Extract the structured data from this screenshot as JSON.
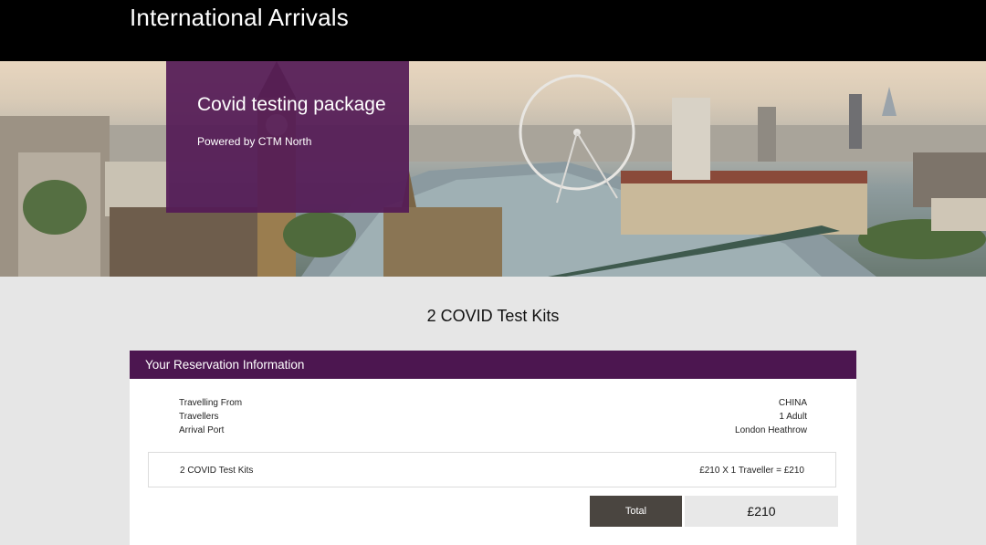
{
  "header": {
    "title": "International Arrivals"
  },
  "hero": {
    "image": "London skyline panorama with London Eye, River Thames and Big Ben",
    "promo": {
      "title": "Covid testing package",
      "subtitle": "Powered by CTM North"
    }
  },
  "product": {
    "heading": "2 COVID Test Kits"
  },
  "reservation": {
    "header": "Your Reservation Information",
    "details": [
      {
        "label": "Travelling From",
        "value": "CHINA"
      },
      {
        "label": "Travellers",
        "value": "1 Adult"
      },
      {
        "label": "Arrival Port",
        "value": "London Heathrow"
      }
    ],
    "line_item": {
      "name": "2 COVID Test Kits",
      "calculation": "£210 X 1 Traveller = £210"
    },
    "total": {
      "label": "Total",
      "value": "£210"
    }
  },
  "colors": {
    "topbar": "#000000",
    "brand_purple": "#4c1650",
    "promo_purple": "#541a56",
    "total_label_bg": "#4a4540",
    "page_bg": "#e6e6e6"
  }
}
